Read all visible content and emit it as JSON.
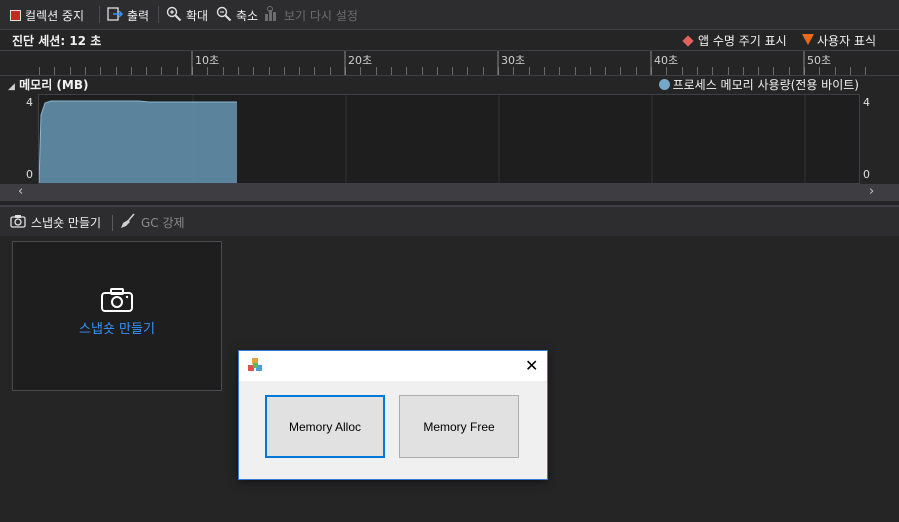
{
  "toolbar": {
    "stop_collection": "컬렉션 중지",
    "output": "출력",
    "zoom_in": "확대",
    "zoom_out": "축소",
    "reset_view": "보기 다시 설정"
  },
  "session": {
    "label": "진단 세션: 12 초",
    "legend_app_lifecycle": "앱 수명 주기 표시",
    "legend_user_marks": "사용자 표식"
  },
  "timeline": {
    "ticks": [
      "10초",
      "20초",
      "30초",
      "40초",
      "50초"
    ]
  },
  "memory": {
    "title": "메모리 (MB)",
    "legend": "프로세스 메모리 사용량(전용 바이트)",
    "y_max_left": "4",
    "y_min_left": "0",
    "y_max_right": "4",
    "y_min_right": "0"
  },
  "tabs": {
    "snapshot": "스냅숏 만들기",
    "force_gc": "GC 강제"
  },
  "snapshot_card": {
    "label": "스냅숏 만들기"
  },
  "dialog": {
    "alloc_label": "Memory Alloc",
    "free_label": "Memory Free"
  },
  "colors": {
    "accent": "#3794ff",
    "memory_fill": "#5f8aa3",
    "app_lifecycle": "#e2625e",
    "user_mark": "#e86a1a"
  }
}
